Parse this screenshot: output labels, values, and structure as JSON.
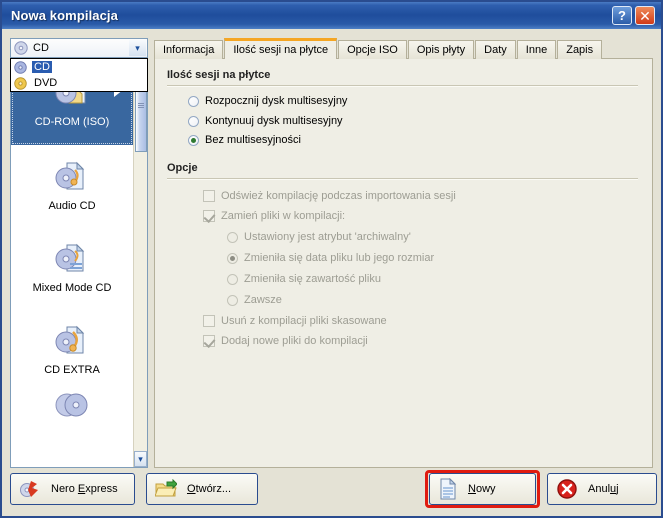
{
  "window": {
    "title": "Nowa kompilacja",
    "help_button": "?",
    "close_button": "✕",
    "accent_title_bar": "#1f4d9c",
    "highlight_color": "#e01b10"
  },
  "media_combo": {
    "selected": "CD",
    "icon": "cd-disc-icon",
    "expanded": true,
    "options": [
      {
        "label": "CD",
        "icon": "cd-disc-blue-icon",
        "selected": true
      },
      {
        "label": "DVD",
        "icon": "dvd-disc-yellow-icon",
        "selected": false
      }
    ]
  },
  "compilation_list": {
    "items": [
      {
        "label": "CD-ROM (ISO)",
        "icon": "cd-rom-iso-icon",
        "selected": true,
        "has_submenu": true
      },
      {
        "label": "Audio CD",
        "icon": "audio-cd-icon",
        "selected": false,
        "has_submenu": false
      },
      {
        "label": "Mixed Mode CD",
        "icon": "mixed-mode-cd-icon",
        "selected": false,
        "has_submenu": false
      },
      {
        "label": "CD EXTRA",
        "icon": "cd-extra-icon",
        "selected": false,
        "has_submenu": false
      },
      {
        "label": "",
        "icon": "copy-cd-icon",
        "selected": false,
        "has_submenu": false
      }
    ],
    "scroll_down_arrow": "▾"
  },
  "tabs": [
    {
      "label": "Informacja",
      "active": false
    },
    {
      "label": "Ilość sesji na płytce",
      "active": true
    },
    {
      "label": "Opcje ISO",
      "active": false
    },
    {
      "label": "Opis płyty",
      "active": false
    },
    {
      "label": "Daty",
      "active": false
    },
    {
      "label": "Inne",
      "active": false
    },
    {
      "label": "Zapis",
      "active": false
    }
  ],
  "panel": {
    "session_section": {
      "title": "Ilość sesji na płytce",
      "radios": [
        {
          "label": "Rozpocznij dysk multisesyjny",
          "checked": false,
          "disabled": false
        },
        {
          "label": "Kontynuuj dysk multisesyjny",
          "checked": false,
          "disabled": false
        },
        {
          "label": "Bez multisesyjności",
          "checked": true,
          "disabled": false
        }
      ]
    },
    "options_section": {
      "title": "Opcje",
      "refresh_checkbox": {
        "label": "Odśwież kompilację podczas importowania sesji",
        "checked": false,
        "disabled": true
      },
      "replace_checkbox": {
        "label": "Zamień pliki w kompilacji:",
        "checked": true,
        "disabled": true
      },
      "replace_radios": [
        {
          "label": "Ustawiony jest atrybut 'archiwalny'",
          "checked": false,
          "disabled": true
        },
        {
          "label": "Zmieniła się data pliku lub jego rozmiar",
          "checked": true,
          "disabled": true
        },
        {
          "label": "Zmieniła się zawartość pliku",
          "checked": false,
          "disabled": true
        },
        {
          "label": "Zawsze",
          "checked": false,
          "disabled": true
        }
      ],
      "remove_checkbox": {
        "label": "Usuń z kompilacji pliki skasowane",
        "checked": false,
        "disabled": true
      },
      "add_checkbox": {
        "label": "Dodaj nowe pliki do kompilacji",
        "checked": true,
        "disabled": true
      }
    }
  },
  "buttons": {
    "nero_express": {
      "pre": "Nero ",
      "accel": "E",
      "post": "xpress",
      "icon": "nero-express-icon"
    },
    "open": {
      "pre": "",
      "accel": "O",
      "post": "twórz...",
      "icon": "open-folder-icon"
    },
    "new": {
      "pre": "",
      "accel": "N",
      "post": "owy",
      "icon": "new-document-icon",
      "highlighted": true
    },
    "cancel": {
      "pre": "Anul",
      "accel": "u",
      "post": "j",
      "icon": "cancel-circle-icon"
    }
  }
}
